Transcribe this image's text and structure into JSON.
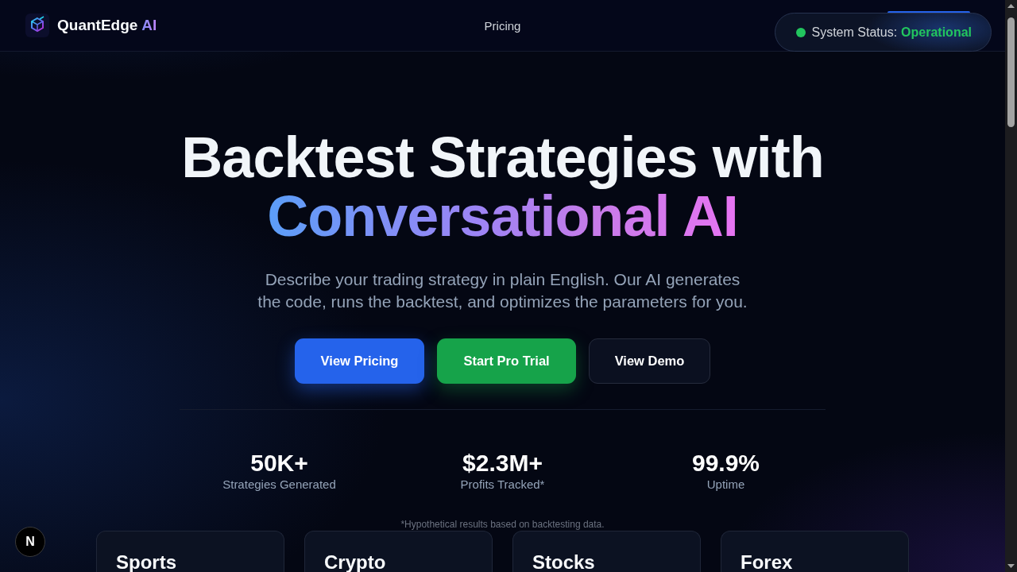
{
  "nav": {
    "brand": {
      "name": "QuantEdge",
      "accent": "AI"
    },
    "links": [
      {
        "label": "Pricing"
      }
    ],
    "status": {
      "label": "System Status:",
      "value": "Operational",
      "kind": "operational"
    }
  },
  "hero": {
    "title": "Backtest Strategies with",
    "title_accent": "Conversational AI",
    "subtitle": "Describe your trading strategy in plain English. Our AI generates the code, runs the backtest, and optimizes the parameters for you.",
    "buttons": [
      {
        "label": "View Pricing",
        "kind": "primary"
      },
      {
        "label": "Start Pro Trial",
        "kind": "success"
      },
      {
        "label": "View Demo",
        "kind": "secondary"
      }
    ]
  },
  "stats": [
    {
      "value": "50K+",
      "label": "Strategies Generated"
    },
    {
      "value": "$2.3M+",
      "label": "Profits Tracked*"
    },
    {
      "value": "99.9%",
      "label": "Uptime"
    }
  ],
  "footnote": "*Hypothetical results based on backtesting data.",
  "markets": [
    {
      "title": "Sports"
    },
    {
      "title": "Crypto"
    },
    {
      "title": "Stocks"
    },
    {
      "title": "Forex"
    }
  ],
  "dev_badge": {
    "label": "N"
  }
}
